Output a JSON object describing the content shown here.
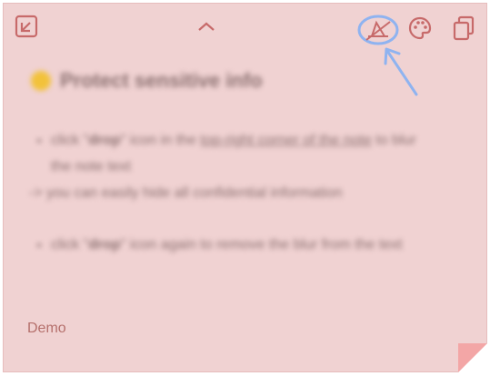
{
  "toolbar": {
    "left_icon": "checkbox-arrow-icon",
    "center_icon": "chevron-up-icon",
    "right_icons": [
      "blur-toggle-icon",
      "palette-icon",
      "copy-icon"
    ],
    "accent": "#c76a6a"
  },
  "note": {
    "background": "#f0d2d2",
    "title": "Protect sensitive info",
    "bullet1_pre": "click \"",
    "bullet1_bold": "drop",
    "bullet1_mid": "\" icon in the ",
    "bullet1_link": "top-right corner of the note",
    "bullet1_post": " to blur the note text",
    "arrow_line": "-> you can easily hide all confidential information",
    "bullet2_pre": "click \"",
    "bullet2_bold": "drop",
    "bullet2_post": "\" icon again to remove the blur from the text"
  },
  "footer": {
    "label": "Demo"
  },
  "annotation": {
    "highlight_color": "#8fb3f0"
  }
}
